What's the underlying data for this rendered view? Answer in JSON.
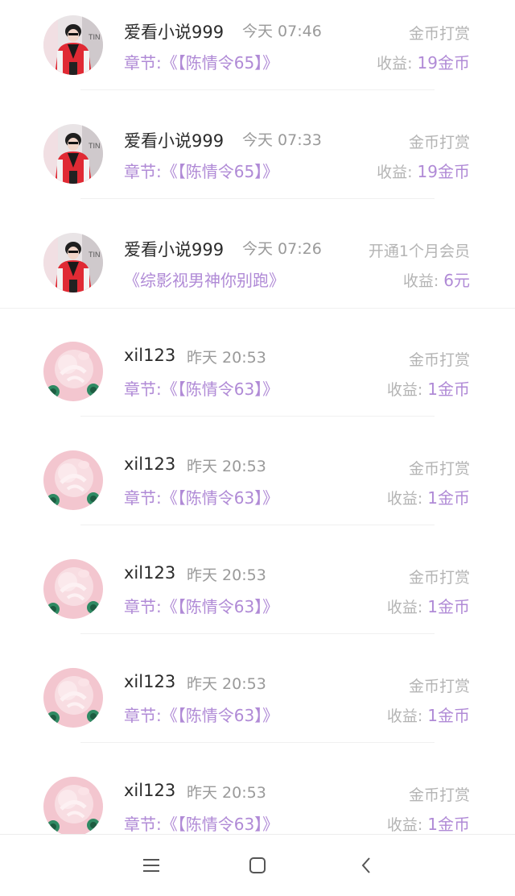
{
  "records": [
    {
      "avatar": "user-photo-red-jacket",
      "user": "爱看小说999",
      "time": "今天 07:46",
      "type": "金币打赏",
      "item": "章节:《【陈情令65】》",
      "income_label": "收益:",
      "income_value": "19金币"
    },
    {
      "avatar": "user-photo-red-jacket",
      "user": "爱看小说999",
      "time": "今天 07:33",
      "type": "金币打赏",
      "item": "章节:《【陈情令65】》",
      "income_label": "收益:",
      "income_value": "19金币"
    },
    {
      "avatar": "user-photo-red-jacket",
      "user": "爱看小说999",
      "time": "今天 07:26",
      "type": "开通1个月会员",
      "item": "《综影视男神你别跑》",
      "income_label": "收益:",
      "income_value": "6元"
    },
    {
      "avatar": "user-photo-pink-plush",
      "user": "xil123",
      "time": "昨天 20:53",
      "type": "金币打赏",
      "item": "章节:《【陈情令63】》",
      "income_label": "收益:",
      "income_value": "1金币"
    },
    {
      "avatar": "user-photo-pink-plush",
      "user": "xil123",
      "time": "昨天 20:53",
      "type": "金币打赏",
      "item": "章节:《【陈情令63】》",
      "income_label": "收益:",
      "income_value": "1金币"
    },
    {
      "avatar": "user-photo-pink-plush",
      "user": "xil123",
      "time": "昨天 20:53",
      "type": "金币打赏",
      "item": "章节:《【陈情令63】》",
      "income_label": "收益:",
      "income_value": "1金币"
    },
    {
      "avatar": "user-photo-pink-plush",
      "user": "xil123",
      "time": "昨天 20:53",
      "type": "金币打赏",
      "item": "章节:《【陈情令63】》",
      "income_label": "收益:",
      "income_value": "1金币"
    },
    {
      "avatar": "user-photo-pink-plush",
      "user": "xil123",
      "time": "昨天 20:53",
      "type": "金币打赏",
      "item": "章节:《【陈情令63】》",
      "income_label": "收益:",
      "income_value": "1金币"
    }
  ],
  "navbar": {
    "menu_icon": "menu-icon",
    "home_icon": "home-square-icon",
    "back_icon": "back-chevron-icon"
  },
  "colors": {
    "accent": "#b08ad6",
    "name_text": "#2b2b2b",
    "secondary_text": "#9a9a9a",
    "label_text": "#b4b4b4"
  }
}
